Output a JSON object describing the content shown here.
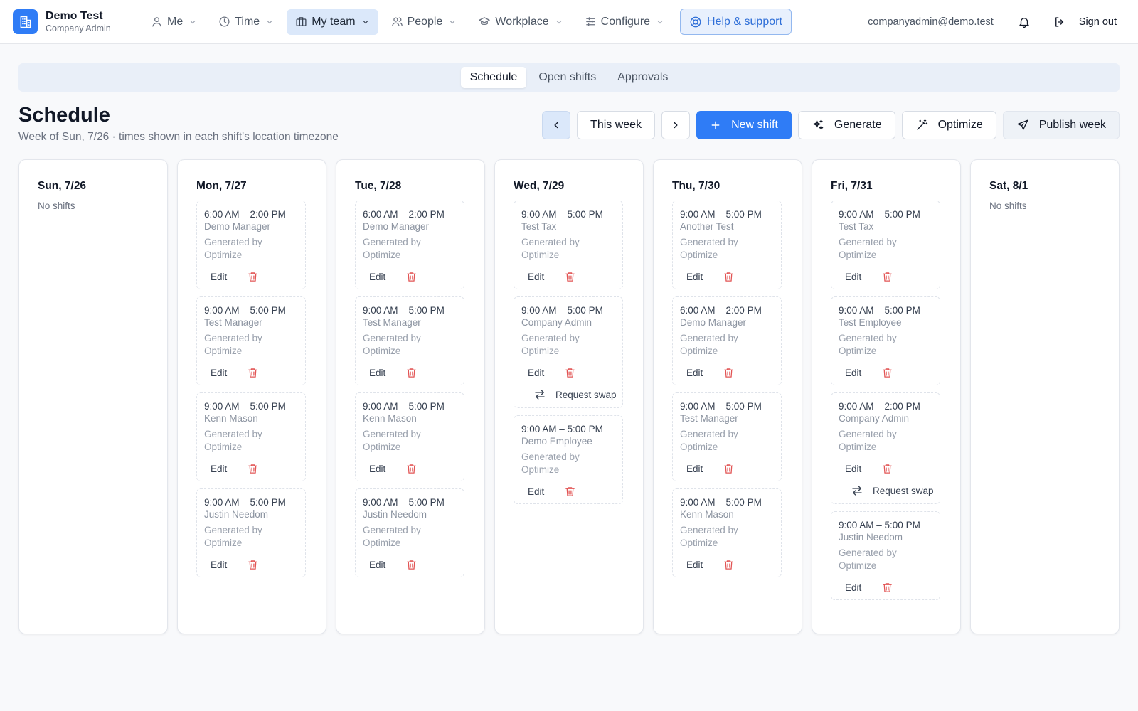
{
  "brand": {
    "name": "Demo Test",
    "role": "Company Admin"
  },
  "nav": [
    {
      "label": "Me",
      "icon": "user-icon"
    },
    {
      "label": "Time",
      "icon": "clock-icon"
    },
    {
      "label": "My team",
      "icon": "briefcase-icon",
      "active": true
    },
    {
      "label": "People",
      "icon": "users-icon"
    },
    {
      "label": "Workplace",
      "icon": "graduation-cap-icon"
    },
    {
      "label": "Configure",
      "icon": "sliders-icon"
    }
  ],
  "help_label": "Help & support",
  "user_email": "companyadmin@demo.test",
  "signout_label": "Sign out",
  "subtabs": [
    {
      "label": "Schedule",
      "active": true
    },
    {
      "label": "Open shifts"
    },
    {
      "label": "Approvals"
    }
  ],
  "page": {
    "title": "Schedule",
    "subtitle": "Week of Sun, 7/26 · times shown in each shift's location timezone"
  },
  "toolbar": {
    "this_week": "This week",
    "new_shift": "New shift",
    "generate": "Generate",
    "optimize": "Optimize",
    "publish_week": "Publish week"
  },
  "labels": {
    "no_shifts": "No shifts",
    "edit": "Edit",
    "request_swap": "Request swap",
    "generated_by": "Generated by Optimize"
  },
  "accent_color": "#2f7cf6",
  "danger_color": "#e25555",
  "days": [
    {
      "label": "Sun, 7/26",
      "shifts": []
    },
    {
      "label": "Mon, 7/27",
      "shifts": [
        {
          "time": "6:00 AM – 2:00 PM",
          "person": "Demo Manager"
        },
        {
          "time": "9:00 AM – 5:00 PM",
          "person": "Test Manager"
        },
        {
          "time": "9:00 AM – 5:00 PM",
          "person": "Kenn Mason"
        },
        {
          "time": "9:00 AM – 5:00 PM",
          "person": "Justin Needom"
        }
      ]
    },
    {
      "label": "Tue, 7/28",
      "shifts": [
        {
          "time": "6:00 AM – 2:00 PM",
          "person": "Demo Manager"
        },
        {
          "time": "9:00 AM – 5:00 PM",
          "person": "Test Manager"
        },
        {
          "time": "9:00 AM – 5:00 PM",
          "person": "Kenn Mason"
        },
        {
          "time": "9:00 AM – 5:00 PM",
          "person": "Justin Needom"
        }
      ]
    },
    {
      "label": "Wed, 7/29",
      "shifts": [
        {
          "time": "9:00 AM – 5:00 PM",
          "person": "Test Tax"
        },
        {
          "time": "9:00 AM – 5:00 PM",
          "person": "Company Admin",
          "swap": true
        },
        {
          "time": "9:00 AM – 5:00 PM",
          "person": "Demo Employee"
        }
      ]
    },
    {
      "label": "Thu, 7/30",
      "shifts": [
        {
          "time": "9:00 AM – 5:00 PM",
          "person": "Another Test"
        },
        {
          "time": "6:00 AM – 2:00 PM",
          "person": "Demo Manager"
        },
        {
          "time": "9:00 AM – 5:00 PM",
          "person": "Test Manager"
        },
        {
          "time": "9:00 AM – 5:00 PM",
          "person": "Kenn Mason"
        }
      ]
    },
    {
      "label": "Fri, 7/31",
      "shifts": [
        {
          "time": "9:00 AM – 5:00 PM",
          "person": "Test Tax"
        },
        {
          "time": "9:00 AM – 5:00 PM",
          "person": "Test Employee"
        },
        {
          "time": "9:00 AM – 2:00 PM",
          "person": "Company Admin",
          "swap": true
        },
        {
          "time": "9:00 AM – 5:00 PM",
          "person": "Justin Needom"
        }
      ]
    },
    {
      "label": "Sat, 8/1",
      "shifts": []
    }
  ]
}
